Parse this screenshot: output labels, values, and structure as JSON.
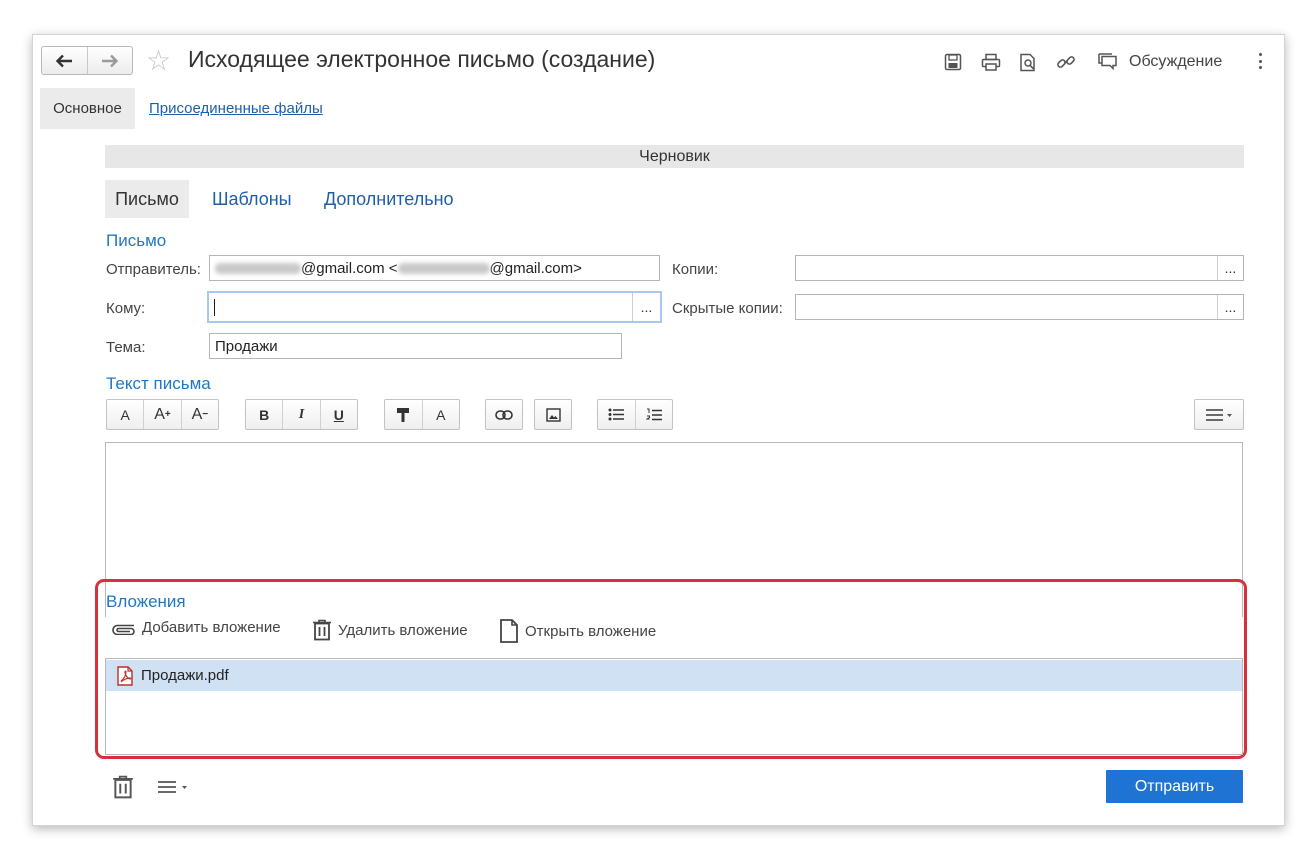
{
  "window": {
    "title": "Исходящее электронное письмо (создание)",
    "discussion_label": "Обсуждение"
  },
  "page_tabs": {
    "main": "Основное",
    "files": "Присоединенные файлы"
  },
  "status": "Черновик",
  "subtabs": {
    "letter": "Письмо",
    "templates": "Шаблоны",
    "extra": "Дополнительно"
  },
  "letter_section": {
    "title": "Письмо",
    "sender_label": "Отправитель:",
    "sender_mid": "@gmail.com <",
    "sender_end": "@gmail.com>",
    "copies_label": "Копии:",
    "to_label": "Кому:",
    "to_value": "",
    "bcc_label": "Скрытые копии:",
    "subject_label": "Тема:",
    "subject_value": "Продажи",
    "dots": "..."
  },
  "text_section": {
    "title": "Текст письма"
  },
  "toolbar": {
    "font": "A",
    "font_bigger": "A",
    "font_smaller": "A",
    "bold": "B",
    "italic": "I",
    "underline": "U",
    "color": "A"
  },
  "attachments": {
    "title": "Вложения",
    "add": "Добавить вложение",
    "delete": "Удалить вложение",
    "open": "Открыть вложение",
    "files": [
      {
        "name": "Продажи.pdf"
      }
    ]
  },
  "footer": {
    "send": "Отправить"
  },
  "colors": {
    "accent": "#1f74d3",
    "highlight": "#d8303a",
    "selection": "#d0e1f4",
    "link": "#1f5fa8"
  }
}
